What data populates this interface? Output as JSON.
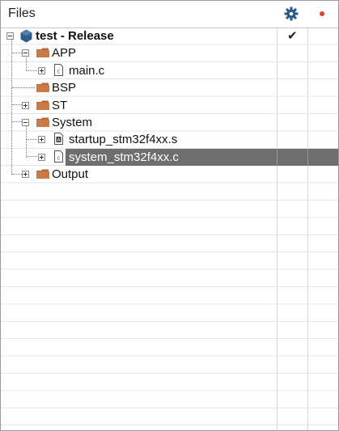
{
  "header": {
    "title": "Files",
    "options_icon": "gear-icon",
    "record_icon": "red-dot-icon"
  },
  "tree": [
    {
      "label": "test - Release",
      "type": "project",
      "expander": "minus",
      "depth": 0,
      "checked": true
    },
    {
      "label": "APP",
      "type": "folder",
      "expander": "minus",
      "depth": 1
    },
    {
      "label": "main.c",
      "type": "c-file",
      "expander": "plus",
      "depth": 2
    },
    {
      "label": "BSP",
      "type": "folder",
      "expander": "none",
      "depth": 1
    },
    {
      "label": "ST",
      "type": "folder",
      "expander": "plus",
      "depth": 1
    },
    {
      "label": "System",
      "type": "folder",
      "expander": "minus",
      "depth": 1
    },
    {
      "label": "startup_stm32f4xx.s",
      "type": "asm-file",
      "expander": "plus",
      "depth": 2
    },
    {
      "label": "system_stm32f4xx.c",
      "type": "c-file",
      "expander": "plus",
      "depth": 2,
      "selected": true
    },
    {
      "label": "Output",
      "type": "folder",
      "expander": "plus",
      "depth": 1
    }
  ],
  "checkmark": "✔",
  "colors": {
    "selection": "#6e6e6e",
    "folder": "#b96a3a",
    "project_icon": "#2f5b86",
    "record_dot": "#e53935",
    "gear": "#2a5a8a"
  }
}
